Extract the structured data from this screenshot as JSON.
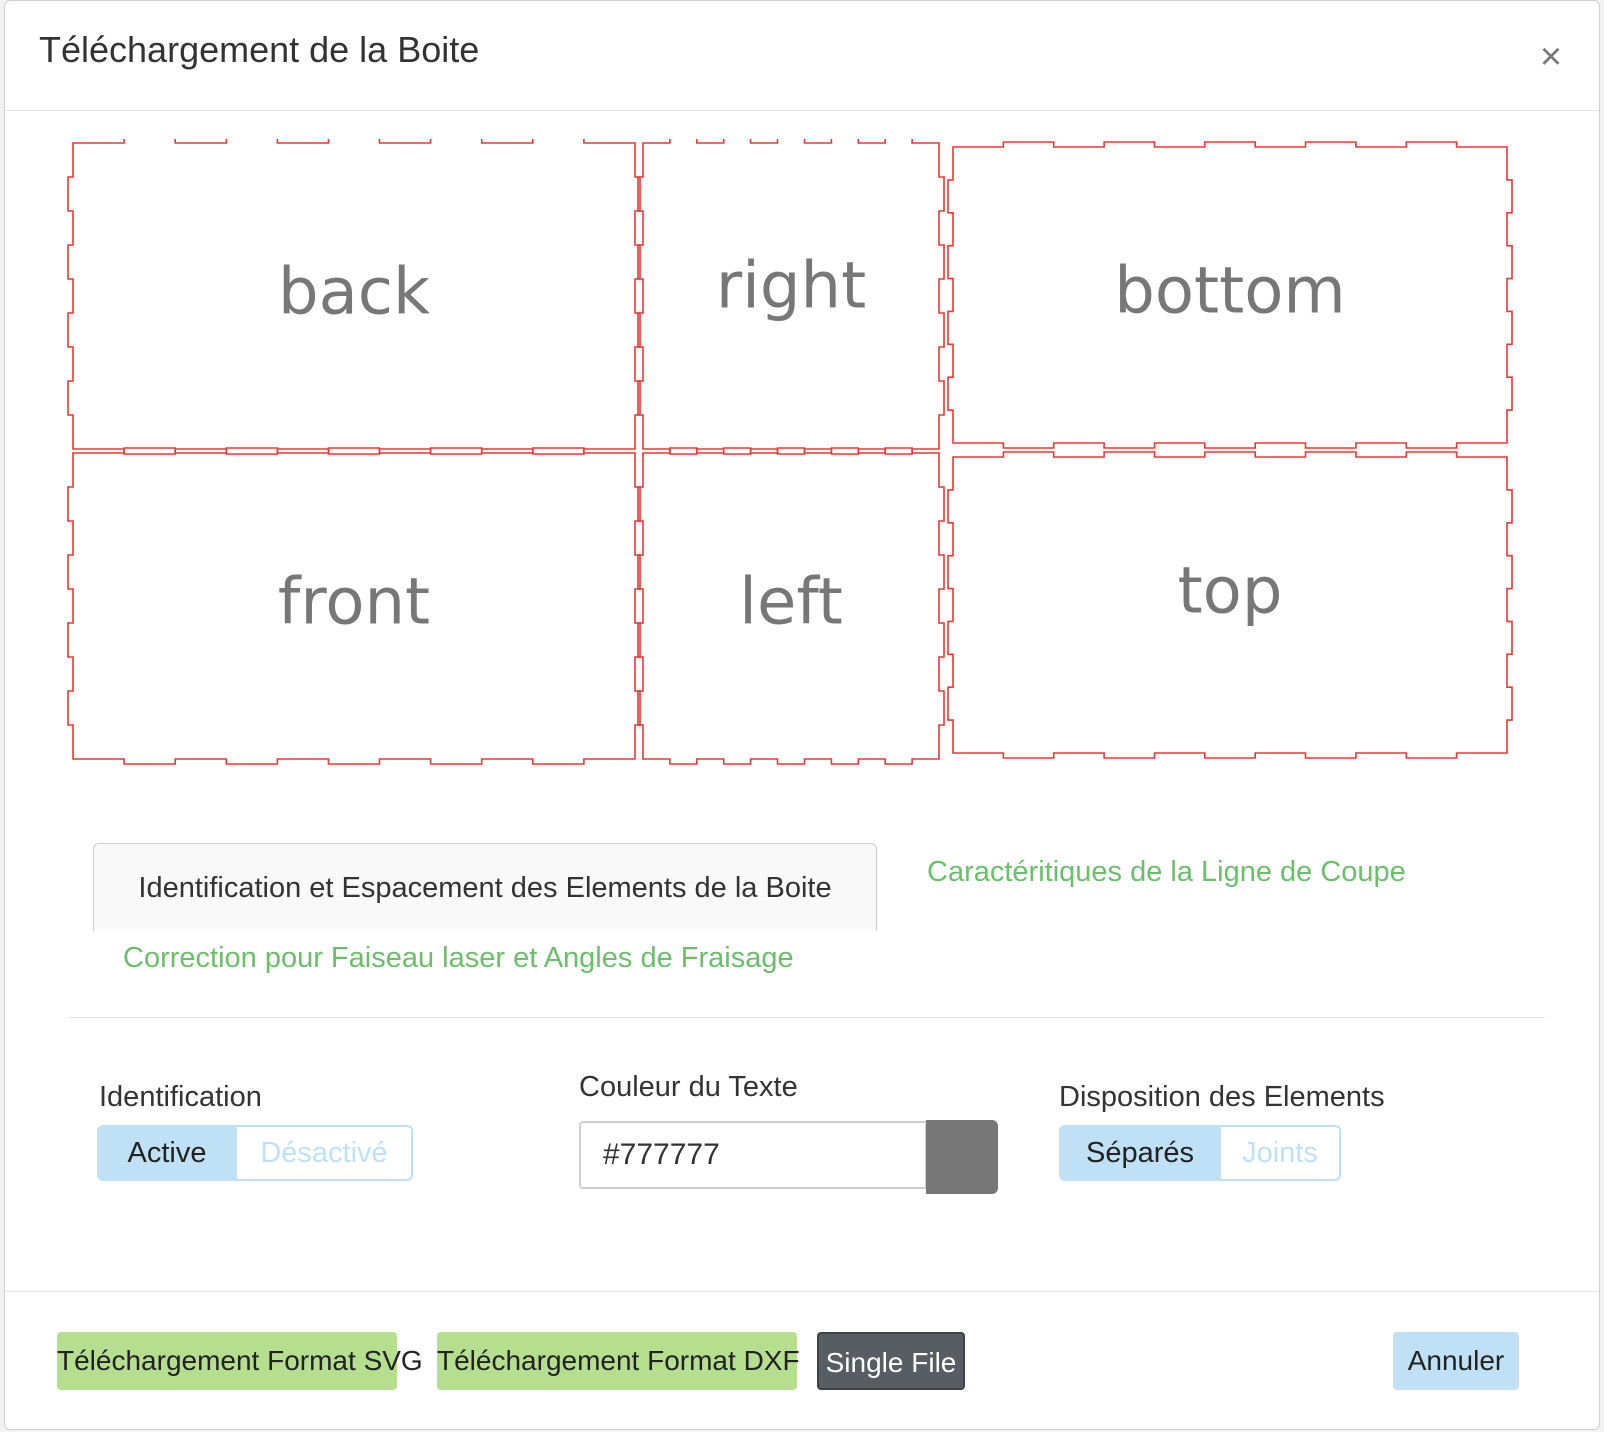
{
  "dialog": {
    "title": "Téléchargement de la Boite",
    "close_symbol": "×"
  },
  "preview": {
    "stroke_color": "#e53935",
    "text_color": "#777777",
    "panels": [
      "back",
      "right",
      "bottom",
      "front",
      "left",
      "top"
    ]
  },
  "tabs": {
    "active": "Identification et Espacement des Elements de la Boite",
    "link_1": "Caractéritiques de la Ligne de Coupe",
    "link_2": "Correction pour Faiseau laser et Angles de Fraisage"
  },
  "identification": {
    "label": "Identification",
    "on": "Active",
    "off": "Désactivé"
  },
  "text_color": {
    "label": "Couleur du Texte",
    "value": "#777777"
  },
  "layout": {
    "label": "Disposition des Elements",
    "on": "Séparés",
    "off": "Joints"
  },
  "footer": {
    "svg_button": "Téléchargement Format SVG",
    "dxf_button": "Téléchargement Format DXF",
    "single_file_button": "Single File",
    "cancel_button": "Annuler"
  }
}
